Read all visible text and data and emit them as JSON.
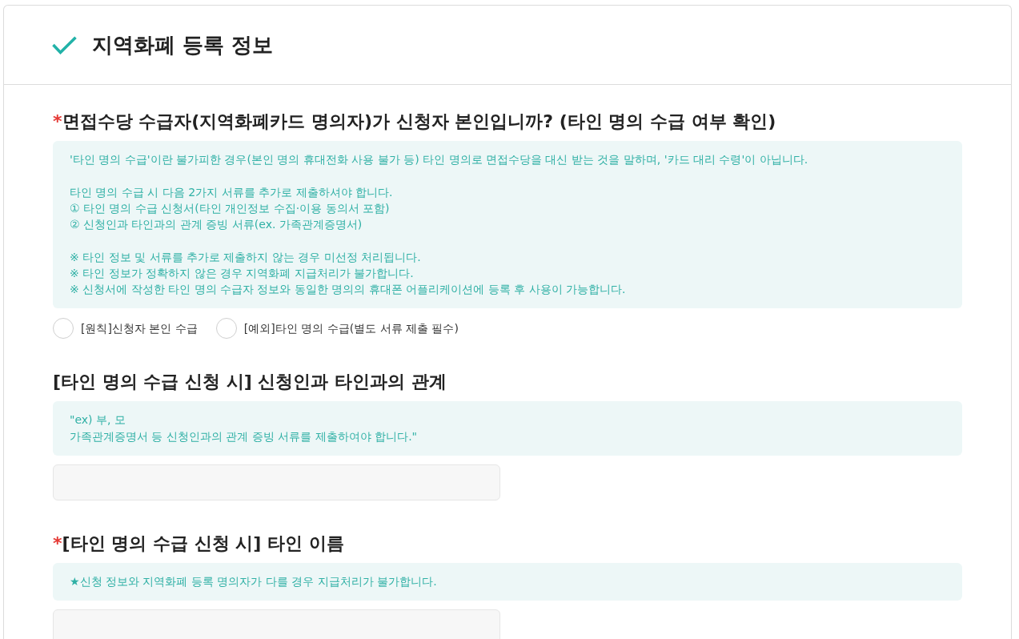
{
  "header": {
    "title": "지역화폐 등록 정보"
  },
  "questions": [
    {
      "kind": "radio",
      "required_mark": "*",
      "title": "면접수당 수급자(지역화폐카드 명의자)가 신청자 본인입니까? (타인 명의 수급 여부 확인)",
      "info": [
        "'타인 명의 수급'이란 불가피한 경우(본인 명의 휴대전화 사용 불가 등) 타인 명의로 면접수당을 대신 받는 것을 말하며, '카드 대리 수령'이 아닙니다.",
        "타인 명의 수급 시 다음 2가지 서류를 추가로 제출하셔야 합니다.\n① 타인 명의 수급 신청서(타인 개인정보 수집·이용 동의서 포함)\n② 신청인과 타인과의 관계 증빙 서류(ex. 가족관계증명서)",
        "※ 타인 정보 및 서류를 추가로 제출하지 않는 경우 미선정 처리됩니다.\n※ 타인 정보가 정확하지 않은 경우 지역화폐 지급처리가 불가합니다.\n※ 신청서에 작성한 타인 명의 수급자 정보와 동일한 명의의 휴대폰 어플리케이션에 등록 후 사용이 가능합니다."
      ],
      "options": [
        {
          "label": "[원칙]신청자 본인 수급",
          "selected": false
        },
        {
          "label": "[예외]타인 명의 수급(별도 서류 제출 필수)",
          "selected": false
        }
      ]
    },
    {
      "kind": "text",
      "title": "[타인 명의 수급 신청 시] 신청인과 타인과의 관계",
      "info": [
        "\"ex) 부, 모\n가족관계증명서 등 신청인과의 관계 증빙 서류를 제출하여야 합니다.\""
      ]
    },
    {
      "kind": "text",
      "required_mark": "*",
      "title": "[타인 명의 수급 신청 시] 타인 이름",
      "info": [
        "★신청 정보와 지역화폐 등록 명의자가 다를 경우 지급처리가 불가합니다."
      ]
    }
  ]
}
